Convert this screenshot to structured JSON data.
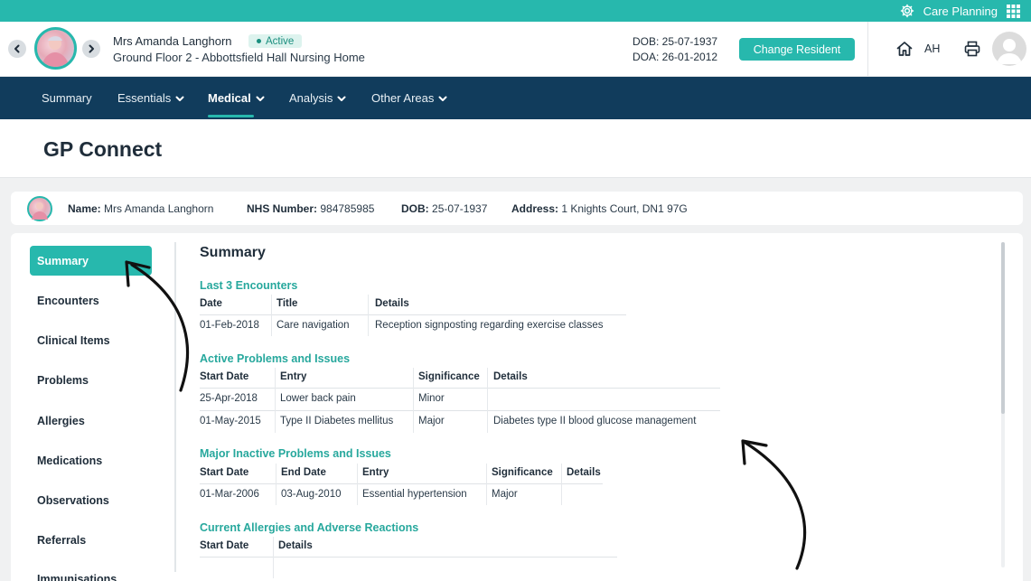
{
  "topbar": {
    "module_label": "Care Planning",
    "icons": [
      "gear-icon",
      "apps-grid-icon"
    ]
  },
  "resident": {
    "name": "Mrs Amanda Langhorn",
    "status": "Active",
    "location": "Ground Floor 2 - Abbottsfield Hall Nursing Home",
    "dob": "DOB: 25-07-1937",
    "doa": "DOA: 26-01-2012",
    "change_label": "Change Resident"
  },
  "header_right": {
    "initials": "AH",
    "icons": [
      "home-icon",
      "print-icon",
      "user-avatar"
    ]
  },
  "nav": {
    "items": [
      {
        "label": "Summary",
        "dropdown": false
      },
      {
        "label": "Essentials",
        "dropdown": true
      },
      {
        "label": "Medical",
        "dropdown": true,
        "active": true
      },
      {
        "label": "Analysis",
        "dropdown": true
      },
      {
        "label": "Other Areas",
        "dropdown": true
      }
    ]
  },
  "page": {
    "title": "GP Connect"
  },
  "patient_card": {
    "name_label": "Name:",
    "name": "Mrs Amanda Langhorn",
    "nhs_label": "NHS Number:",
    "nhs": "984785985",
    "dob_label": "DOB:",
    "dob": "25-07-1937",
    "address_label": "Address:",
    "address": "1 Knights Court, DN1 97G"
  },
  "sidebar": {
    "items": [
      {
        "label": "Summary",
        "active": true
      },
      {
        "label": "Encounters"
      },
      {
        "label": "Clinical Items"
      },
      {
        "label": "Problems"
      },
      {
        "label": "Allergies"
      },
      {
        "label": "Medications"
      },
      {
        "label": "Observations"
      },
      {
        "label": "Referrals"
      },
      {
        "label": "Immunisations"
      }
    ]
  },
  "summary": {
    "title": "Summary",
    "encounters": {
      "heading": "Last 3 Encounters",
      "columns": [
        "Date",
        "Title",
        "Details"
      ],
      "rows": [
        [
          "01-Feb-2018",
          "Care navigation",
          "Reception signposting regarding exercise classes"
        ]
      ]
    },
    "active_problems": {
      "heading": "Active Problems and Issues",
      "columns": [
        "Start Date",
        "Entry",
        "Significance",
        "Details"
      ],
      "rows": [
        [
          "25-Apr-2018",
          "Lower back pain",
          "Minor",
          ""
        ],
        [
          "01-May-2015",
          "Type II Diabetes mellitus",
          "Major",
          "Diabetes type II blood glucose management"
        ]
      ]
    },
    "inactive_problems": {
      "heading": "Major Inactive Problems and Issues",
      "columns": [
        "Start Date",
        "End Date",
        "Entry",
        "Significance",
        "Details"
      ],
      "rows": [
        [
          "01-Mar-2006",
          "03-Aug-2010",
          "Essential hypertension",
          "Major",
          ""
        ]
      ]
    },
    "allergies": {
      "heading": "Current Allergies and Adverse Reactions",
      "columns": [
        "Start Date",
        "Details"
      ]
    }
  }
}
